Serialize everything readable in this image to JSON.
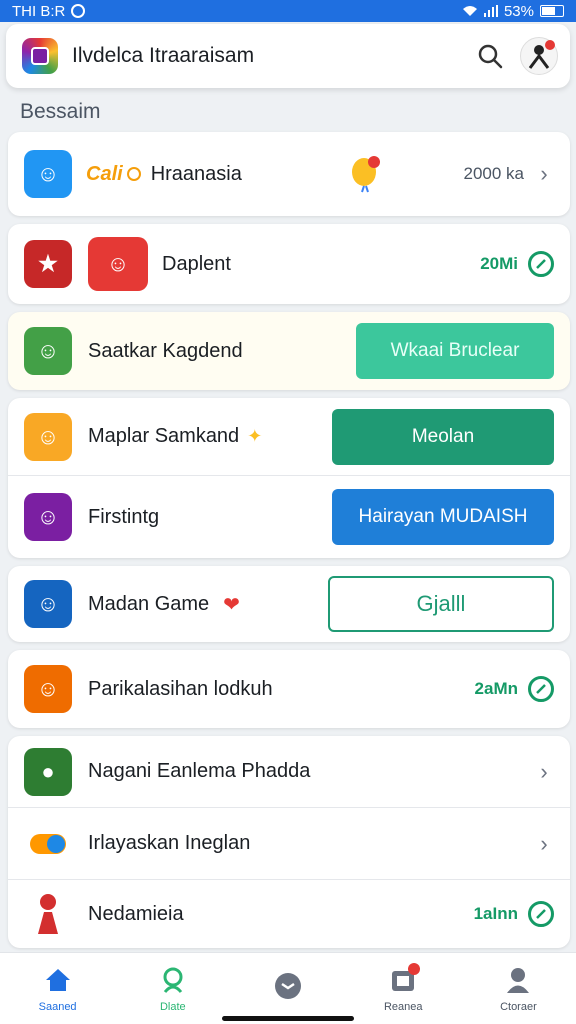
{
  "status_bar": {
    "time": "THI B:R",
    "battery": "53%"
  },
  "header": {
    "title": "Ilvdelca Itraaraisam"
  },
  "section_title": "Bessaim",
  "items": [
    {
      "label": "Hraanasia",
      "value": "2000 ka",
      "icon": "game-icon-face",
      "color": "#2196f3"
    },
    {
      "label": "Daplent",
      "value": "20Mi",
      "icon": "game-icon-characters",
      "color": "#c62828"
    },
    {
      "label": "Saatkar Kagdend",
      "button": "Wkaai Bruclear",
      "icon": "game-icon-clown",
      "color": "#43a047"
    },
    {
      "label": "Maplar Samkand",
      "button": "Meolan",
      "icon": "game-icon-frog",
      "color": "#f9a825"
    },
    {
      "label": "Firstintg",
      "button": "Hairayan MUDAISH",
      "icon": "game-icon-panda",
      "color": "#7b1fa2"
    },
    {
      "label": "Madan Game",
      "button": "Gjalll",
      "icon": "game-icon-boy",
      "color": "#1565c0"
    },
    {
      "label": "Parikalasihan lodkuh",
      "value": "2aMn",
      "icon": "game-icon-smiley",
      "color": "#ef6c00"
    },
    {
      "label": "Nagani Eanlema Phadda",
      "icon": "game-icon-bird",
      "color": "#2e7d32"
    },
    {
      "label": "Irlayaskan Ineglan",
      "icon": "game-icon-toggle",
      "color": "#ff9800"
    },
    {
      "label": "Nedamieia",
      "value": "1aInn",
      "icon": "game-icon-figure",
      "color": "#d32f2f"
    }
  ],
  "colors": {
    "accent": "#1f6fe0",
    "green": "#159a66",
    "teal": "#1f9a74"
  },
  "nav": [
    {
      "label": "Saaned",
      "icon": "home-icon",
      "active": true
    },
    {
      "label": "Dlate",
      "icon": "location-icon"
    },
    {
      "label": "",
      "icon": "game-controller-icon"
    },
    {
      "label": "Reanea",
      "icon": "inbox-icon"
    },
    {
      "label": "Ctoraer",
      "icon": "profile-icon"
    }
  ]
}
